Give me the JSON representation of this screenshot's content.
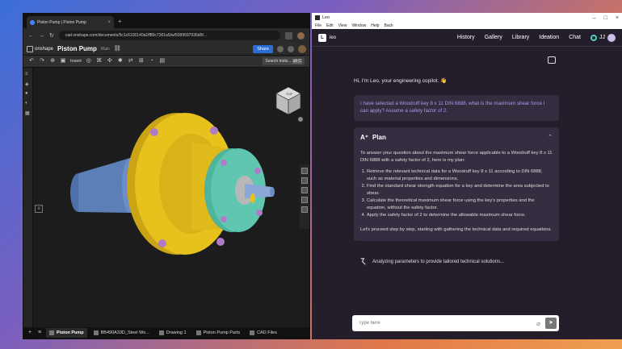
{
  "browser": {
    "tab_title": "Piston Pump | Piston Pump",
    "new_tab": "+",
    "url": "cad.onshape.com/documents/5c1c6100140a1ff80c7301a5/w/5099597036d5f...",
    "onshape_logo": "onshape",
    "doc_name": "Piston Pump",
    "branch": "Main",
    "share_label": "Share",
    "insert_label": "Insert",
    "search_tools": "Search tools...",
    "search_shortcut": "alt C",
    "bottom_tabs": [
      {
        "label": "Piston Pump",
        "active": true
      },
      {
        "label": "BB490A33D_Steel Wo...",
        "active": false
      },
      {
        "label": "Drawing 1",
        "active": false
      },
      {
        "label": "Piston Pump Parts",
        "active": false
      },
      {
        "label": "CAD Files",
        "active": false
      }
    ],
    "viewcube_face": "TOP"
  },
  "leo": {
    "window_title": "Leo",
    "menus": [
      "File",
      "Edit",
      "View",
      "Window",
      "Help",
      "Back"
    ],
    "brand": "leo",
    "nav_links": [
      "History",
      "Gallery",
      "Library",
      "Ideation",
      "Chat"
    ],
    "user_initials": "JJ",
    "greeting": "Hi, I'm Leo, your engineering copilot. 👋",
    "user_message": "I have selected a Woodruff key 8 x 11 DIN 6888, what is the maximum shear force I can apply? Assume a safety factor of 2.",
    "plan": {
      "title": "Plan",
      "intro": "To answer your question about the maximum shear force applicable to a Woodruff key 8 x 11 DIN 6888 with a safety factor of 2, here is my plan:",
      "steps": [
        "Retrieve the relevant technical data for a Woodruff key 8 x 11 according to DIN 6888, such as material properties and dimensions.",
        "Find the standard shear strength equation for a key and determine the area subjected to shear.",
        "Calculate the theoretical maximum shear force using the key's properties and the equation, without the safety factor.",
        "Apply the safety factor of 2 to determine the allowable maximum shear force."
      ],
      "outro": "Let's proceed step by step, starting with gathering the technical data and required equations."
    },
    "status_text": "Analyzing parameters to provide tailored technical solutions...",
    "input_placeholder": "Type here"
  },
  "colors": {
    "leo_bg": "#241e2b",
    "accent_text": "#a89cf0",
    "part_yellow": "#e8c21c",
    "part_teal": "#5fc7b0",
    "part_blue": "#5d7fb8"
  }
}
